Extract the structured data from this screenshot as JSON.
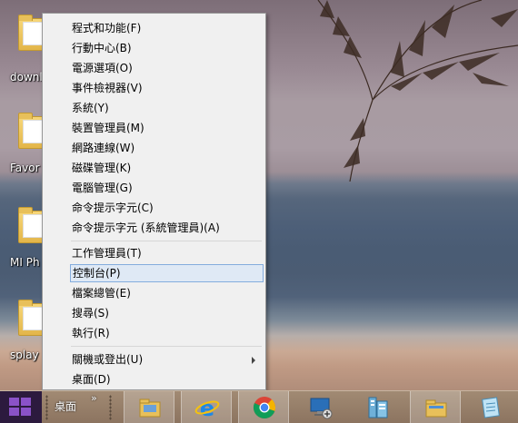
{
  "desktop": {
    "icons": [
      {
        "label": "downl"
      },
      {
        "label": "Favor"
      },
      {
        "label": "MI Ph"
      },
      {
        "label": "splay"
      }
    ]
  },
  "menu": {
    "items": [
      {
        "label": "程式和功能(F)"
      },
      {
        "label": "行動中心(B)"
      },
      {
        "label": "電源選項(O)"
      },
      {
        "label": "事件檢視器(V)"
      },
      {
        "label": "系統(Y)"
      },
      {
        "label": "裝置管理員(M)"
      },
      {
        "label": "網路連線(W)"
      },
      {
        "label": "磁碟管理(K)"
      },
      {
        "label": "電腦管理(G)"
      },
      {
        "label": "命令提示字元(C)"
      },
      {
        "label": "命令提示字元 (系統管理員)(A)"
      },
      {
        "label": "工作管理員(T)"
      },
      {
        "label": "控制台(P)"
      },
      {
        "label": "檔案總管(E)"
      },
      {
        "label": "搜尋(S)"
      },
      {
        "label": "執行(R)"
      },
      {
        "label": "關機或登出(U)"
      },
      {
        "label": "桌面(D)"
      }
    ],
    "selected_index": 12
  },
  "taskbar": {
    "toolbar_label": "桌面",
    "overflow": "»",
    "pinned": [
      {
        "icon": "file-explorer-icon"
      },
      {
        "icon": "internet-explorer-icon"
      },
      {
        "icon": "chrome-icon"
      },
      {
        "icon": "remote-desktop-icon"
      },
      {
        "icon": "server-manager-icon"
      },
      {
        "icon": "folder-icon"
      },
      {
        "icon": "notepad-icon"
      }
    ]
  },
  "colors": {
    "start_accent": "#8a52c8",
    "selection_bg": "#dfe9f5",
    "selection_border": "#84acdd"
  }
}
